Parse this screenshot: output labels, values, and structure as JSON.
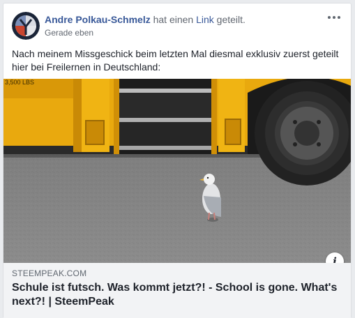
{
  "post": {
    "author": "Andre Polkau-Schmelz",
    "action_verb": "hat einen",
    "action_link": "Link",
    "action_suffix": "geteilt.",
    "timestamp": "Gerade eben",
    "message": "Nach meinem Missgeschick beim letzten Mal diesmal exklusiv zuerst geteilt hier bei Freilernen in Deutschland:",
    "more_icon": "more-horizontal-icon"
  },
  "link_preview": {
    "image_description_icon": "photo",
    "bus_label": "3,500 LBS",
    "domain": "STEEMPEAK.COM",
    "title": "Schule ist futsch. Was kommt jetzt?! - School is gone. What's next?! | SteemPeak",
    "info_glyph": "i"
  },
  "colors": {
    "author": "#385898",
    "background": "#e9ebee",
    "meta_background": "#f2f3f5",
    "bus_yellow": "#e9a90e"
  }
}
